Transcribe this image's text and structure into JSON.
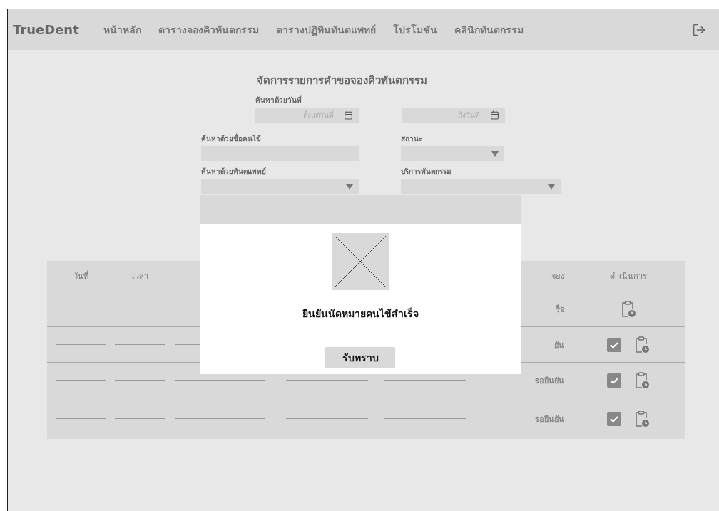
{
  "nav": {
    "brand": "TrueDent",
    "links": [
      {
        "label": "หน้าหลัก"
      },
      {
        "label": "ตารางจองคิวทันตกรรม"
      },
      {
        "label": "ตารางปฏิทินทันตแพทย์"
      },
      {
        "label": "โปรโมชัน"
      },
      {
        "label": "คลินิกทันตกรรม"
      }
    ]
  },
  "title": "จัดการรายการคำขอจองคิวทันตกรรม",
  "filters": {
    "date": {
      "label": "ค้นหาด้วยวันที่",
      "from_placeholder": "ตั้งแต่วันที่",
      "to_placeholder": "ถึงวันที่"
    },
    "patient": {
      "label": "ค้นหาด้วยชื่อคนไข้"
    },
    "status": {
      "label": "สถานะ"
    },
    "dentist": {
      "label": "ค้นหาด้วยทันตแพทย์"
    },
    "service": {
      "label": "บริการทันตกรรม"
    }
  },
  "table": {
    "columns": [
      {
        "label": "วันที่"
      },
      {
        "label": "เวลา"
      },
      {},
      {},
      {},
      {
        "label": "จอง"
      },
      {
        "label": "ดำเนินการ"
      }
    ],
    "rows": [
      {
        "status": "ร็จ",
        "actions": [
          {
            "kind": "history"
          }
        ]
      },
      {
        "status": "ยัน",
        "actions": [
          {
            "kind": "confirm"
          },
          {
            "kind": "history"
          }
        ]
      },
      {
        "status": "รอยืนยัน",
        "actions": [
          {
            "kind": "confirm"
          },
          {
            "kind": "history"
          }
        ]
      },
      {
        "status": "รอยืนยัน",
        "actions": [
          {
            "kind": "confirm"
          },
          {
            "kind": "history"
          }
        ]
      }
    ]
  },
  "modal": {
    "message": "ยืนยันนัดหมายคนไข้สำเร็จ",
    "button": "รับทราบ"
  }
}
